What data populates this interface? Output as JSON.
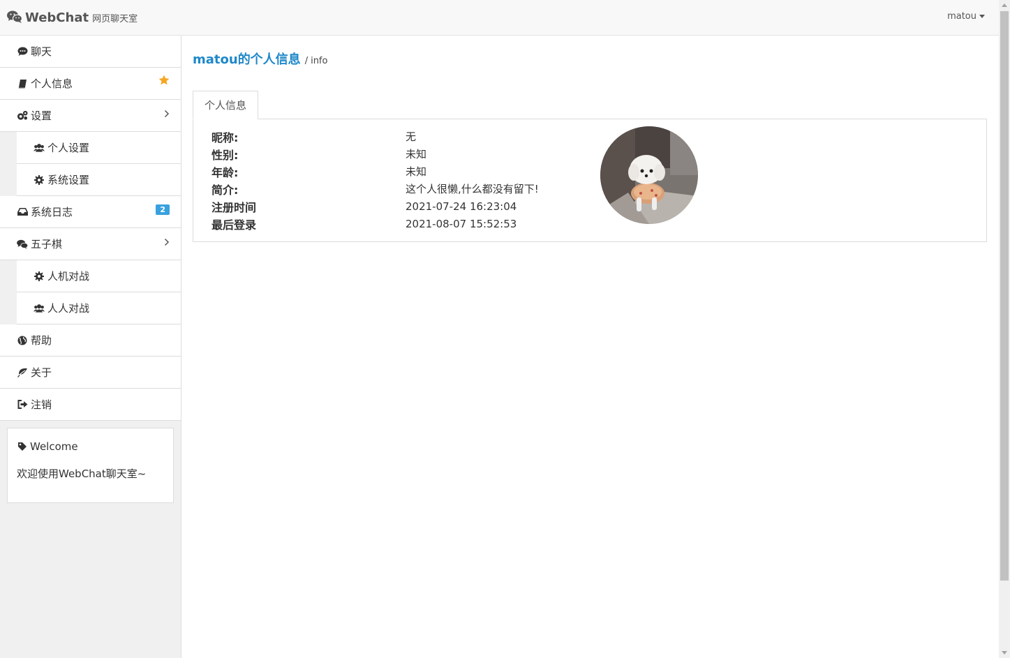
{
  "header": {
    "brand_name": "WebChat",
    "brand_sub": "网页聊天室",
    "user": "matou"
  },
  "sidebar": {
    "items": [
      {
        "label": "聊天",
        "icon": "comment-icon"
      },
      {
        "label": "个人信息",
        "icon": "book-icon",
        "marker": "star-icon"
      },
      {
        "label": "设置",
        "icon": "gears-icon",
        "marker": "chevron-right-icon"
      },
      {
        "label": "个人设置",
        "icon": "users-icon",
        "sub": true
      },
      {
        "label": "系统设置",
        "icon": "gear-icon",
        "sub": true
      },
      {
        "label": "系统日志",
        "icon": "inbox-icon",
        "badge": "2"
      },
      {
        "label": "五子棋",
        "icon": "comments-icon",
        "marker": "chevron-right-icon"
      },
      {
        "label": "人机对战",
        "icon": "gear-icon",
        "sub": true
      },
      {
        "label": "人人对战",
        "icon": "users-icon",
        "sub": true
      },
      {
        "label": "帮助",
        "icon": "globe-icon"
      },
      {
        "label": "关于",
        "icon": "leaf-icon"
      },
      {
        "label": "注销",
        "icon": "sign-out-icon"
      }
    ],
    "welcome": {
      "title": "Welcome",
      "text": "欢迎使用WebChat聊天室~"
    }
  },
  "main": {
    "title": "matou的个人信息",
    "separator": "/",
    "subtitle": "info",
    "tab": "个人信息",
    "fields": [
      {
        "label": "昵称:",
        "value": "无"
      },
      {
        "label": "性别:",
        "value": "未知"
      },
      {
        "label": "年龄:",
        "value": "未知"
      },
      {
        "label": "简介:",
        "value": "这个人很懒,什么都没有留下!"
      },
      {
        "label": "注册时间",
        "value": "2021-07-24 16:23:04"
      },
      {
        "label": "最后登录",
        "value": "2021-08-07 15:52:53"
      }
    ]
  },
  "colors": {
    "accent": "#1e88c9",
    "badge": "#39a1de",
    "star": "#f5a623"
  }
}
